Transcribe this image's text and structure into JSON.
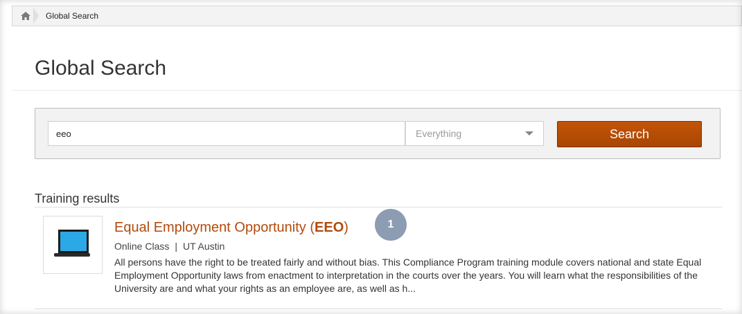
{
  "breadcrumb": {
    "home_icon": "home-icon",
    "current": "Global Search"
  },
  "page": {
    "title": "Global Search"
  },
  "search": {
    "query": "eeo",
    "filter_selected": "Everything",
    "button_label": "Search",
    "button_color": "#b34e05"
  },
  "results": {
    "section_title": "Training results",
    "items": [
      {
        "icon": "laptop-icon",
        "title_prefix": "Equal Employment Opportunity (",
        "title_highlight": "EEO",
        "title_suffix": ")",
        "type": "Online Class",
        "provider": "UT Austin",
        "description": "All persons have the right to be treated fairly and without bias. This Compliance Program training module covers national and state Equal Employment Opportunity laws from enactment to interpretation in the courts over the years. You will learn what the responsibilities of the University are and what your rights as an employee are, as well as h..."
      }
    ]
  },
  "annotation": {
    "callout_number": "1"
  },
  "colors": {
    "link": "#b24a0b",
    "callout": "#8c9cb3"
  }
}
